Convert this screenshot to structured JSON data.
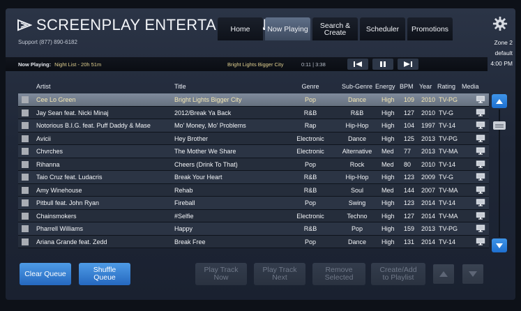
{
  "header": {
    "brand": "SCREENPLAY ENTERTAINMENT",
    "support": "Support (877) 890-6182",
    "tabs": [
      {
        "label": "Home"
      },
      {
        "label": "Now Playing",
        "active": true
      },
      {
        "label": "Search & Create"
      },
      {
        "label": "Scheduler"
      },
      {
        "label": "Promotions"
      }
    ],
    "zone": "Zone 2",
    "zone_default": "default",
    "time": "4:00 PM"
  },
  "now_playing": {
    "label": "Now Playing:",
    "list": "Night List - 20h 51m",
    "track": "Bright Lights Bigger City",
    "time": "0:11 | 3:38"
  },
  "table": {
    "headers": [
      "Artist",
      "Title",
      "Genre",
      "Sub-Genre",
      "Energy",
      "BPM",
      "Year",
      "Rating",
      "Media"
    ],
    "rows": [
      {
        "artist": "Cee Lo Green",
        "title": "Bright Lights Bigger City",
        "genre": "Pop",
        "sub": "Dance",
        "energy": "High",
        "bpm": "109",
        "year": "2010",
        "rating": "TV-PG",
        "selected": true
      },
      {
        "artist": "Jay Sean feat. Nicki Minaj",
        "title": "2012/Break Ya Back",
        "genre": "R&B",
        "sub": "R&B",
        "energy": "High",
        "bpm": "127",
        "year": "2010",
        "rating": "TV-G"
      },
      {
        "artist": "Notorious B.I.G. feat. Puff Daddy & Mase",
        "title": "Mo' Money, Mo' Problems",
        "genre": "Rap",
        "sub": "Hip-Hop",
        "energy": "High",
        "bpm": "104",
        "year": "1997",
        "rating": "TV-14"
      },
      {
        "artist": "Avicii",
        "title": "Hey Brother",
        "genre": "Electronic",
        "sub": "Dance",
        "energy": "High",
        "bpm": "125",
        "year": "2013",
        "rating": "TV-PG"
      },
      {
        "artist": "Chvrches",
        "title": "The Mother We Share",
        "genre": "Electronic",
        "sub": "Alternative",
        "energy": "Med",
        "bpm": "77",
        "year": "2013",
        "rating": "TV-MA"
      },
      {
        "artist": "Rihanna",
        "title": "Cheers (Drink To That)",
        "genre": "Pop",
        "sub": "Rock",
        "energy": "Med",
        "bpm": "80",
        "year": "2010",
        "rating": "TV-14"
      },
      {
        "artist": "Taio Cruz feat. Ludacris",
        "title": "Break Your Heart",
        "genre": "R&B",
        "sub": "Hip-Hop",
        "energy": "High",
        "bpm": "123",
        "year": "2009",
        "rating": "TV-G"
      },
      {
        "artist": "Amy Winehouse",
        "title": "Rehab",
        "genre": "R&B",
        "sub": "Soul",
        "energy": "Med",
        "bpm": "144",
        "year": "2007",
        "rating": "TV-MA"
      },
      {
        "artist": "Pitbull feat. John Ryan",
        "title": "Fireball",
        "genre": "Pop",
        "sub": "Swing",
        "energy": "High",
        "bpm": "123",
        "year": "2014",
        "rating": "TV-14"
      },
      {
        "artist": "Chainsmokers",
        "title": "#Selfie",
        "genre": "Electronic",
        "sub": "Techno",
        "energy": "High",
        "bpm": "127",
        "year": "2014",
        "rating": "TV-MA"
      },
      {
        "artist": "Pharrell Williams",
        "title": "Happy",
        "genre": "R&B",
        "sub": "Pop",
        "energy": "High",
        "bpm": "159",
        "year": "2013",
        "rating": "TV-PG"
      },
      {
        "artist": "Ariana Grande feat. Zedd",
        "title": "Break Free",
        "genre": "Pop",
        "sub": "Dance",
        "energy": "High",
        "bpm": "131",
        "year": "2014",
        "rating": "TV-14"
      }
    ]
  },
  "buttons": {
    "clear_queue": "Clear Queue",
    "shuffle_queue": "Shuffle Queue",
    "play_now": "Play Track Now",
    "play_next": "Play Track Next",
    "remove": "Remove Selected",
    "create_add": "Create/Add to Playlist"
  },
  "colors": {
    "accent_blue": "#2f82da",
    "highlight_text": "#f3e6b3",
    "now_playing_text": "#e0cf8e"
  },
  "icons": {
    "brand": "screenplay-logo-icon",
    "settings": "gear-icon",
    "media": "monitor-icon"
  }
}
